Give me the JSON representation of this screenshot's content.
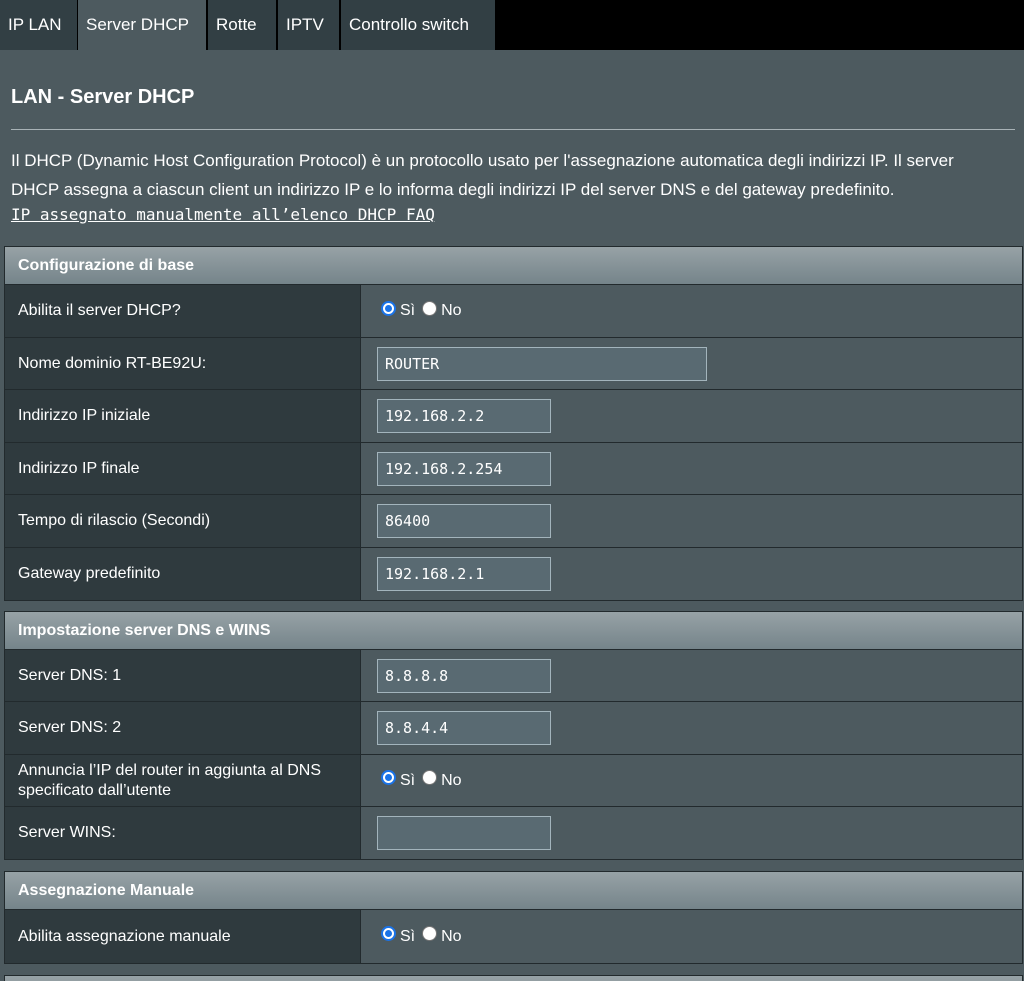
{
  "tabs": [
    "IP LAN",
    "Server DHCP",
    "Rotte",
    "IPTV",
    "Controllo switch"
  ],
  "page_title": "LAN - Server DHCP",
  "description_line1": "Il DHCP (Dynamic Host Configuration Protocol) è un protocollo usato per l'assegnazione automatica degli indirizzi IP. Il server",
  "description_line2": "DHCP assegna a ciascun client un indirizzo IP e lo informa degli indirizzi IP del server DNS e del gateway predefinito.",
  "faq_link": "IP assegnato manualmente all’elenco DHCP FAQ",
  "basic_config": {
    "header": "Configurazione di base",
    "enable_dhcp": {
      "label": "Abilita il server DHCP?",
      "yes": "Sì",
      "no": "No",
      "selected": "yes"
    },
    "domain_name": {
      "label": "Nome dominio RT-BE92U:",
      "value": "ROUTER"
    },
    "ip_start": {
      "label": "Indirizzo IP iniziale",
      "value": "192.168.2.2"
    },
    "ip_end": {
      "label": "Indirizzo IP finale",
      "value": "192.168.2.254"
    },
    "lease_time": {
      "label": "Tempo di rilascio (Secondi)",
      "value": "86400"
    },
    "gateway": {
      "label": "Gateway predefinito",
      "value": "192.168.2.1"
    }
  },
  "dns_wins": {
    "header": "Impostazione server DNS e WINS",
    "dns1": {
      "label": "Server DNS: 1",
      "value": "8.8.8.8"
    },
    "dns2": {
      "label": "Server DNS: 2",
      "value": "8.8.4.4"
    },
    "advertise": {
      "label_line1": "Annuncia l’IP del router in aggiunta al DNS",
      "label_line2": "specificato dall’utente",
      "yes": "Sì",
      "no": "No",
      "selected": "yes"
    },
    "wins": {
      "label": "Server WINS:",
      "value": ""
    }
  },
  "manual_assign": {
    "header": "Assegnazione Manuale",
    "enable": {
      "label": "Abilita assegnazione manuale",
      "yes": "Sì",
      "no": "No",
      "selected": "yes"
    }
  }
}
